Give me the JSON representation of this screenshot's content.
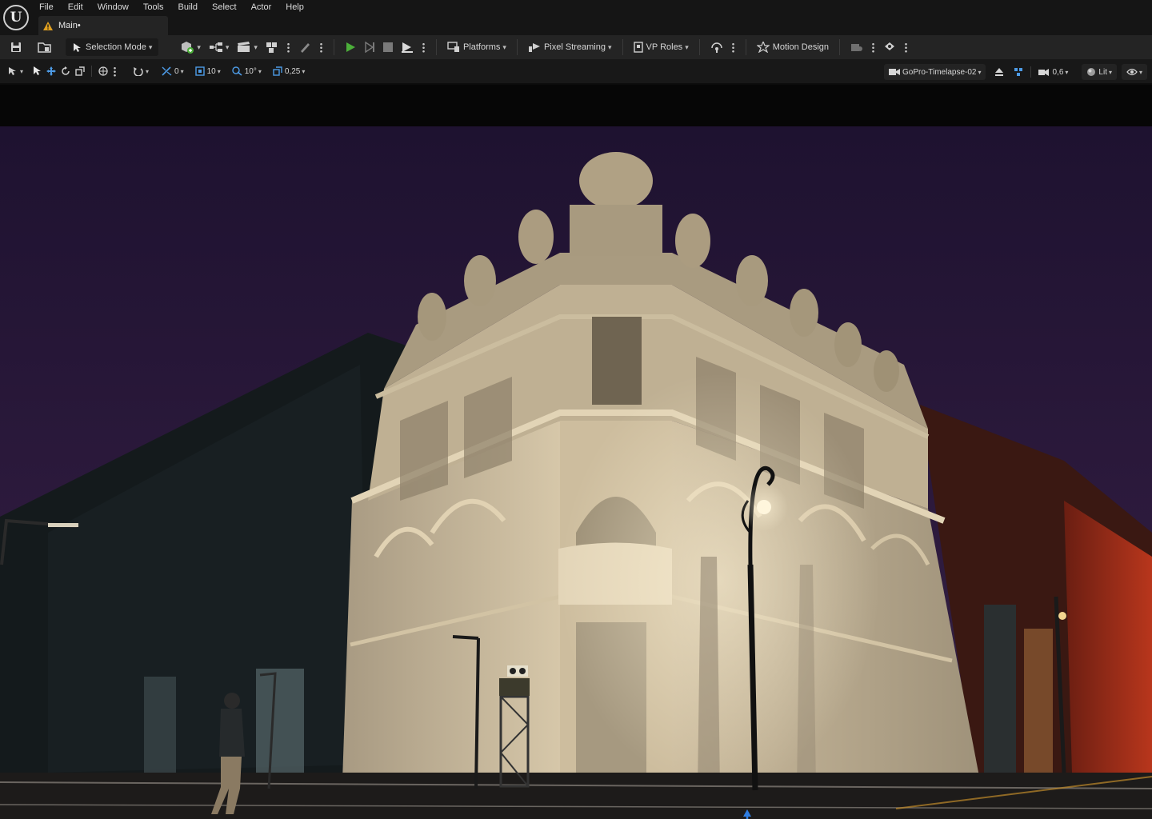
{
  "menu": {
    "items": [
      "File",
      "Edit",
      "Window",
      "Tools",
      "Build",
      "Select",
      "Actor",
      "Help"
    ],
    "logo_icon": "unreal-engine-logo"
  },
  "document_tab": {
    "label": "Main•",
    "icon": "warning-icon"
  },
  "toolbar": {
    "selection_mode_label": "Selection Mode",
    "platforms_label": "Platforms",
    "pixel_streaming_label": "Pixel Streaming",
    "vp_roles_label": "VP Roles",
    "motion_design_label": "Motion Design",
    "play_color": "#4caf3a"
  },
  "viewport_toolbar": {
    "translate_snap_value": "0",
    "grid_snap_value": "10",
    "rotation_snap_value": "10°",
    "scale_snap_value": "0,25",
    "camera_label": "GoPro-Timelapse-02",
    "camera_speed_value": "0,6",
    "view_mode_label": "Lit"
  },
  "scene": {
    "sky_color": "#2a1738",
    "facade_light_color": "#d8c8a8",
    "gizmo_axes": {
      "x": "#e8581c",
      "y": "#5aa832",
      "z": "#2f7de0"
    }
  }
}
